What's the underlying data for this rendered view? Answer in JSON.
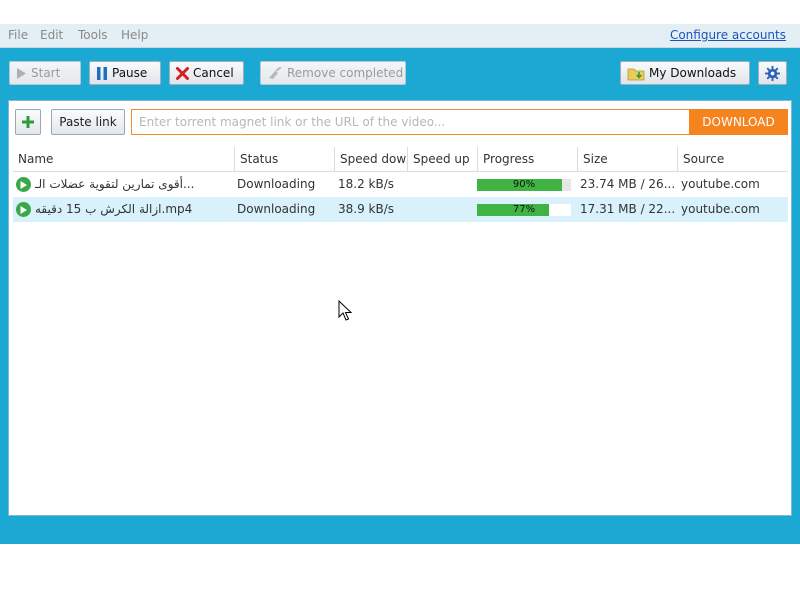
{
  "menubar": {
    "items": [
      "File",
      "Edit",
      "Tools",
      "Help"
    ],
    "configure_label": "Configure accounts"
  },
  "toolbar": {
    "start_label": "Start",
    "pause_label": "Pause",
    "cancel_label": "Cancel",
    "remove_label": "Remove completed",
    "my_downloads_label": "My Downloads",
    "settings_icon": "gear-icon"
  },
  "add_bar": {
    "paste_label": "Paste link",
    "placeholder": "Enter torrent magnet link or the URL of the video...",
    "download_label": "DOWNLOAD"
  },
  "table": {
    "columns": [
      "Name",
      "Status",
      "Speed down",
      "Speed up",
      "Progress",
      "Size",
      "Source"
    ],
    "rows": [
      {
        "name": "أقوى تمارين لتقوية عضلات الـ...",
        "status": "Downloading",
        "speed_down": "18.2 kB/s",
        "speed_up": "",
        "progress": 90,
        "progress_label": "90%",
        "size": "23.74 MB / 26....",
        "source": "youtube.com"
      },
      {
        "name": "ازالة الكرش ب 15 دقيقه.mp4",
        "status": "Downloading",
        "speed_down": "38.9 kB/s",
        "speed_up": "",
        "progress": 77,
        "progress_label": "77%",
        "size": "17.31 MB / 22....",
        "source": "youtube.com"
      }
    ]
  },
  "colors": {
    "frame": "#1ba9d3",
    "accent": "#f5841f",
    "progress": "#3fb444",
    "selected_row": "#d8f1fb"
  }
}
